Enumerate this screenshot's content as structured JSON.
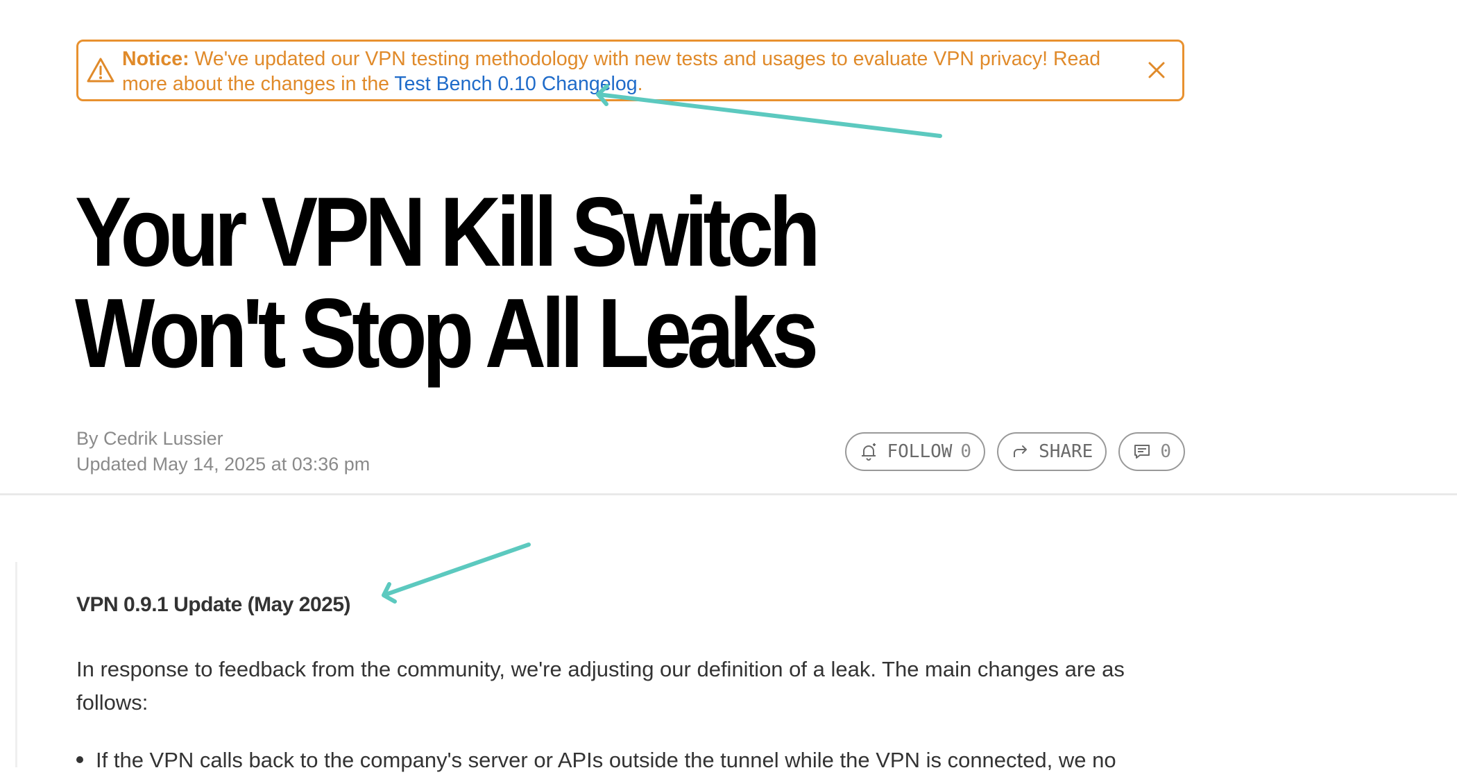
{
  "notice": {
    "label": "Notice:",
    "text": " We've updated our VPN testing methodology with new tests and usages to evaluate VPN privacy! Read more about the changes in the ",
    "link_text": "Test Bench 0.10 Changelog",
    "trailing": ".",
    "accent_color": "#e8912f",
    "link_color": "#1f6bc9",
    "icon": "warning-icon",
    "close_icon": "close-icon"
  },
  "article": {
    "title": "Your VPN Kill Switch Won't Stop All Leaks",
    "byline": "By Cedrik Lussier",
    "updated": "Updated May 14, 2025 at 03:36 pm"
  },
  "actions": {
    "follow_label": "FOLLOW",
    "follow_count": "0",
    "share_label": "SHARE",
    "comments_count": "0"
  },
  "content": {
    "update_heading": "VPN 0.9.1 Update (May 2025)",
    "paragraph": "In response to feedback from the community, we're adjusting our definition of a leak. The main changes are as follows:",
    "bullet_1": "If the VPN calls back to the company's server or APIs outside the tunnel while the VPN is connected, we no"
  },
  "annotations": {
    "arrow_color": "#5cc9bf"
  }
}
